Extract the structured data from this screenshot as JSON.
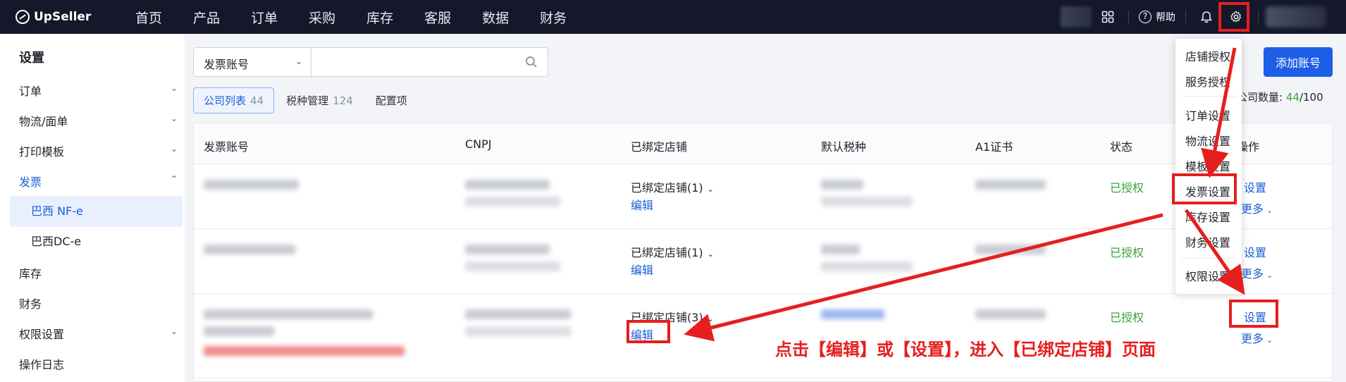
{
  "topbar": {
    "brand": "UpSeller",
    "nav": [
      "首页",
      "产品",
      "订单",
      "采购",
      "库存",
      "客服",
      "数据",
      "财务"
    ],
    "help_label": "帮助",
    "icons": [
      "apps-grid-icon",
      "help-circle-icon",
      "bell-icon",
      "gear-icon"
    ]
  },
  "sidebar": {
    "title": "设置",
    "items": [
      {
        "label": "订单",
        "chevron": "down"
      },
      {
        "label": "物流/面单",
        "chevron": "down"
      },
      {
        "label": "打印模板",
        "chevron": "down"
      },
      {
        "label": "发票",
        "chevron": "up",
        "active": true
      },
      {
        "label": "巴西 NF-e",
        "sub": true,
        "selected": true
      },
      {
        "label": "巴西DC-e",
        "sub": true
      },
      {
        "label": "库存"
      },
      {
        "label": "财务"
      },
      {
        "label": "权限设置",
        "chevron": "down"
      },
      {
        "label": "操作日志"
      }
    ]
  },
  "search": {
    "select_value": "发票账号",
    "placeholder": ""
  },
  "add_button_label": "添加账号",
  "tabs": [
    {
      "label": "公司列表",
      "count": "44",
      "active": true
    },
    {
      "label": "税种管理",
      "count": "124"
    },
    {
      "label": "配置项",
      "count": ""
    }
  ],
  "quota": {
    "label": "公司数量:",
    "used": "44",
    "total": "/100"
  },
  "table": {
    "headers": [
      "发票账号",
      "CNPJ",
      "已绑定店铺",
      "默认税种",
      "A1证书",
      "状态",
      "操作"
    ],
    "rows": [
      {
        "bound": "已绑定店铺(1)",
        "edit": "编辑",
        "status": "已授权",
        "op_main": "设置",
        "op_more": "更多"
      },
      {
        "bound": "已绑定店铺(1)",
        "edit": "编辑",
        "status": "已授权",
        "op_main": "设置",
        "op_more": "更多"
      },
      {
        "bound": "已绑定店铺(3)",
        "edit": "编辑",
        "status": "已授权",
        "op_main": "设置",
        "op_more": "更多"
      }
    ]
  },
  "settings_menu": {
    "groups": [
      [
        "店铺授权",
        "服务授权"
      ],
      [
        "订单设置",
        "物流设置",
        "模板设置",
        "发票设置",
        "库存设置",
        "财务设置"
      ],
      [
        "权限设置"
      ]
    ]
  },
  "annotation": {
    "text": "点击【编辑】或【设置】，进入【已绑定店铺】页面",
    "color": "#e61e1e"
  },
  "colors": {
    "primary": "#1c5ee6",
    "success": "#3aa33a",
    "topbar": "#14182a",
    "highlight": "#e61e1e"
  }
}
